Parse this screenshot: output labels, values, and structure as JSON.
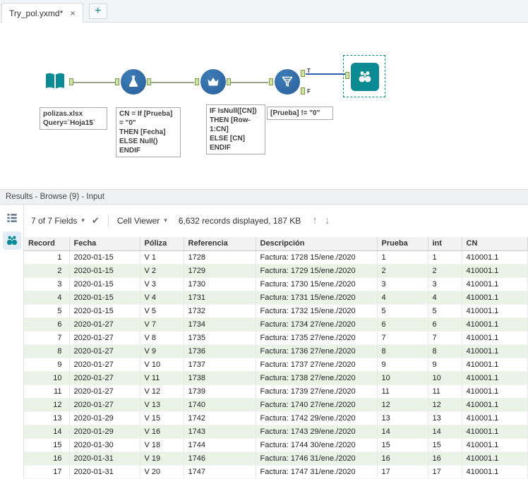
{
  "window": {
    "tab_title": "Try_pol.yxmd*",
    "close_glyph": "×",
    "new_tab_glyph": "+"
  },
  "colors": {
    "accent_teal": "#0a8a93",
    "tool_blue": "#2e6da4",
    "row_alt_green": "#e9f4e7",
    "selected_wire_blue": "#2f5fae",
    "anchor_green": "#cfe3a8"
  },
  "canvas": {
    "tool_names": [
      "input-data",
      "formula",
      "multi-row-formula",
      "filter",
      "browse"
    ],
    "annotations": {
      "input": "polizas.xlsx\nQuery=`Hoja1$`",
      "formula": "CN = If [Prueba]\n= \"0\"\nTHEN [Fecha]\nELSE Null()\nENDIF",
      "multirow": "IF IsNull([CN])\nTHEN [Row-1:CN]\nELSE [CN]\nENDIF",
      "filter": "[Prueba] != \"0\""
    },
    "filter_true_label": "T",
    "filter_false_label": "F"
  },
  "results": {
    "header_title": "Results - Browse (9) - Input",
    "toolbar": {
      "fields_label": "7 of 7 Fields",
      "caret": "▾",
      "check_glyph": "✔",
      "cell_viewer_label": "Cell Viewer",
      "status_text": "6,632 records displayed, 187 KB",
      "up_glyph": "↑",
      "down_glyph": "↓"
    },
    "table": {
      "columns": [
        "Record",
        "Fecha",
        "Póliza",
        "Referencia",
        "Descripción",
        "Prueba",
        "int",
        "CN"
      ],
      "rows": [
        [
          "1",
          "2020-01-15",
          "V 1",
          "1728",
          "Factura: 1728 15/ene./2020",
          "1",
          "1",
          "410001.1"
        ],
        [
          "2",
          "2020-01-15",
          "V 2",
          "1729",
          "Factura: 1729 15/ene./2020",
          "2",
          "2",
          "410001.1"
        ],
        [
          "3",
          "2020-01-15",
          "V 3",
          "1730",
          "Factura: 1730 15/ene./2020",
          "3",
          "3",
          "410001.1"
        ],
        [
          "4",
          "2020-01-15",
          "V 4",
          "1731",
          "Factura: 1731 15/ene./2020",
          "4",
          "4",
          "410001.1"
        ],
        [
          "5",
          "2020-01-15",
          "V 5",
          "1732",
          "Factura: 1732 15/ene./2020",
          "5",
          "5",
          "410001.1"
        ],
        [
          "6",
          "2020-01-27",
          "V 7",
          "1734",
          "Factura: 1734 27/ene./2020",
          "6",
          "6",
          "410001.1"
        ],
        [
          "7",
          "2020-01-27",
          "V 8",
          "1735",
          "Factura: 1735 27/ene./2020",
          "7",
          "7",
          "410001.1"
        ],
        [
          "8",
          "2020-01-27",
          "V 9",
          "1736",
          "Factura: 1736 27/ene./2020",
          "8",
          "8",
          "410001.1"
        ],
        [
          "9",
          "2020-01-27",
          "V 10",
          "1737",
          "Factura: 1737 27/ene./2020",
          "9",
          "9",
          "410001.1"
        ],
        [
          "10",
          "2020-01-27",
          "V 11",
          "1738",
          "Factura: 1738 27/ene./2020",
          "10",
          "10",
          "410001.1"
        ],
        [
          "11",
          "2020-01-27",
          "V 12",
          "1739",
          "Factura: 1739 27/ene./2020",
          "11",
          "11",
          "410001.1"
        ],
        [
          "12",
          "2020-01-27",
          "V 13",
          "1740",
          "Factura: 1740 27/ene./2020",
          "12",
          "12",
          "410001.1"
        ],
        [
          "13",
          "2020-01-29",
          "V 15",
          "1742",
          "Factura: 1742 29/ene./2020",
          "13",
          "13",
          "410001.1"
        ],
        [
          "14",
          "2020-01-29",
          "V 16",
          "1743",
          "Factura: 1743 29/ene./2020",
          "14",
          "14",
          "410001.1"
        ],
        [
          "15",
          "2020-01-30",
          "V 18",
          "1744",
          "Factura: 1744 30/ene./2020",
          "15",
          "15",
          "410001.1"
        ],
        [
          "16",
          "2020-01-31",
          "V 19",
          "1746",
          "Factura: 1746 31/ene./2020",
          "16",
          "16",
          "410001.1"
        ],
        [
          "17",
          "2020-01-31",
          "V 20",
          "1747",
          "Factura: 1747 31/ene./2020",
          "17",
          "17",
          "410001.1"
        ]
      ]
    }
  }
}
